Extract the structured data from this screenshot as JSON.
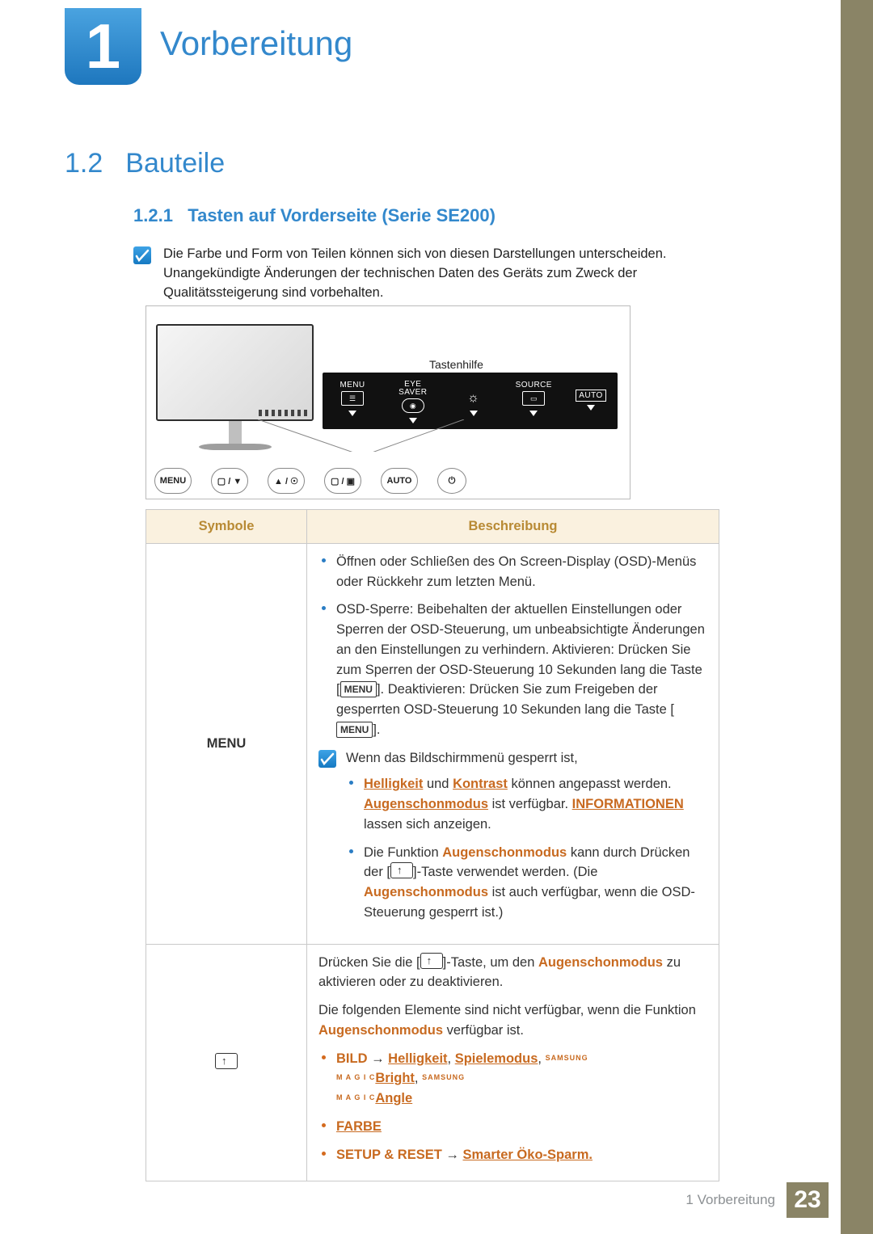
{
  "chapter": {
    "num": "1",
    "title": "Vorbereitung"
  },
  "section": {
    "num": "1.2",
    "title": "Bauteile"
  },
  "subsection": {
    "num": "1.2.1",
    "title": "Tasten auf Vorderseite (Serie SE200)"
  },
  "note1": "Die Farbe und Form von Teilen können sich von diesen Darstellungen unterscheiden. Unangekündigte Änderungen der technischen Daten des Geräts zum Zweck der Qualitätssteigerung sind vorbehalten.",
  "diagram": {
    "panel_label": "Tastenhilfe",
    "menu": "MENU",
    "eye": "EYE SAVER",
    "source": "SOURCE",
    "auto": "AUTO",
    "circles": [
      "MENU",
      "▢ / ▼",
      "▲ / ☉",
      "▢ / ▣",
      "AUTO",
      "⏻"
    ]
  },
  "table": {
    "h1": "Symbole",
    "h2": "Beschreibung",
    "row1": {
      "sym": "MENU",
      "b1": "Öffnen oder Schließen des On Screen-Display (OSD)-Menüs oder Rückkehr zum letzten Menü.",
      "b2a": "OSD-Sperre: Beibehalten der aktuellen Einstellungen oder Sperren der OSD-Steuerung, um unbeabsichtigte Änderungen an den Einstellungen zu verhindern. Aktivieren: Drücken Sie zum Sperren der OSD-Steuerung 10 Sekunden lang die Taste [",
      "b2b": "]. Deaktivieren: Drücken Sie zum Freigeben der gesperrten OSD-Steuerung 10 Sekunden lang die Taste [",
      "b2c": "].",
      "note_intro": "Wenn das Bildschirmmenü gesperrt ist,",
      "n1a": "Helligkeit",
      "n1b": " und ",
      "n1c": "Kontrast",
      "n1d": " können angepasst werden. ",
      "n1e": "Augenschonmodus",
      "n1f": " ist verfügbar. ",
      "n1g": "INFORMATIONEN",
      "n1h": " lassen sich anzeigen.",
      "n2a": "Die Funktion ",
      "n2b": "Augenschonmodus",
      "n2c": " kann durch Drücken der [",
      "n2d": "]-Taste verwendet werden. (Die ",
      "n2e": "Augenschonmodus",
      "n2f": " ist auch verfügbar, wenn die OSD-Steuerung gesperrt ist.)"
    },
    "row2": {
      "p1a": "Drücken Sie die [",
      "p1b": "]-Taste, um den ",
      "p1c": "Augenschonmodus",
      "p1d": " zu aktivieren oder zu deaktivieren.",
      "p2a": "Die folgenden Elemente sind nicht verfügbar, wenn die Funktion ",
      "p2b": "Augenschonmodus",
      "p2c": " verfügbar ist.",
      "li1a": "BILD",
      "arrow": " → ",
      "li1b": "Helligkeit",
      "comma": ", ",
      "li1c": "Spielemodus",
      "li1d": "Bright",
      "li1e": "Angle",
      "magic": "SAMSUNG MAGIC",
      "li2": "FARBE",
      "li3a": "SETUP & RESET",
      "li3b": "Smarter Öko-Sparm."
    }
  },
  "footer": {
    "text": "1 Vorbereitung",
    "page": "23"
  }
}
